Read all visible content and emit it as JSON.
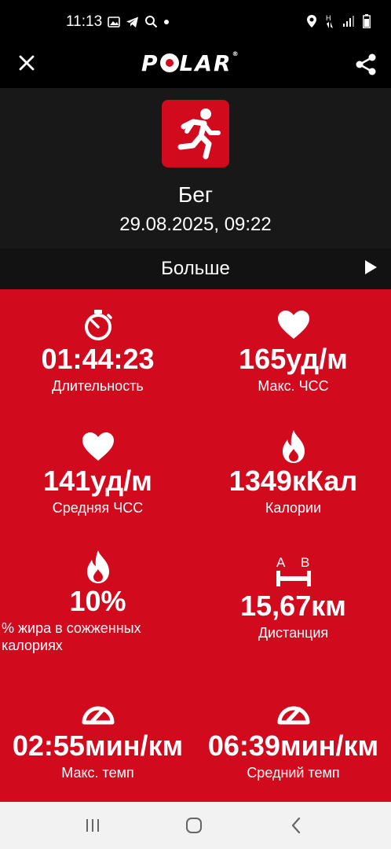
{
  "status_bar": {
    "time": "11:13",
    "left_icons": [
      "image-icon",
      "telegram-icon",
      "search-icon",
      "dot-icon"
    ],
    "right_icons": [
      "location-icon",
      "network-icon",
      "signal-icon",
      "battery-icon"
    ]
  },
  "app_bar": {
    "logo_parts": [
      "P",
      "LAR"
    ],
    "logo_mark": "®",
    "close_icon": "close-icon",
    "share_icon": "share-icon"
  },
  "header": {
    "sport_icon": "running-icon",
    "sport": "Бег",
    "date": "29.08.2025, 09:22"
  },
  "more": {
    "label": "Больше",
    "icon": "play-arrow-icon"
  },
  "stats": [
    {
      "icon": "stopwatch-icon",
      "value": "01:44:23",
      "label": "Длительность"
    },
    {
      "icon": "heart-icon",
      "value": "165уд/м",
      "label": "Макс. ЧСС"
    },
    {
      "icon": "heart-icon",
      "value": "141уд/м",
      "label": "Средняя ЧСС"
    },
    {
      "icon": "flame-icon",
      "value": "1349кКал",
      "label": "Калории"
    },
    {
      "icon": "flame-icon",
      "value": "10%",
      "label": "% жира в сожженных калориях"
    },
    {
      "icon": "distance-icon",
      "value": "15,67км",
      "label": "Дистанция",
      "icon_letters": [
        "A",
        "B"
      ]
    },
    {
      "icon": "speedometer-icon",
      "value": "02:55мин/км",
      "label": "Макс. темп"
    },
    {
      "icon": "speedometer-icon",
      "value": "06:39мин/км",
      "label": "Средний темп"
    }
  ],
  "nav_bar": {
    "buttons": [
      "recents-icon",
      "home-icon",
      "back-icon"
    ]
  },
  "colors": {
    "accent": "#d10a1e",
    "background": "#000000",
    "header_bg": "#181818",
    "nav_bg": "#f2f2f2"
  }
}
